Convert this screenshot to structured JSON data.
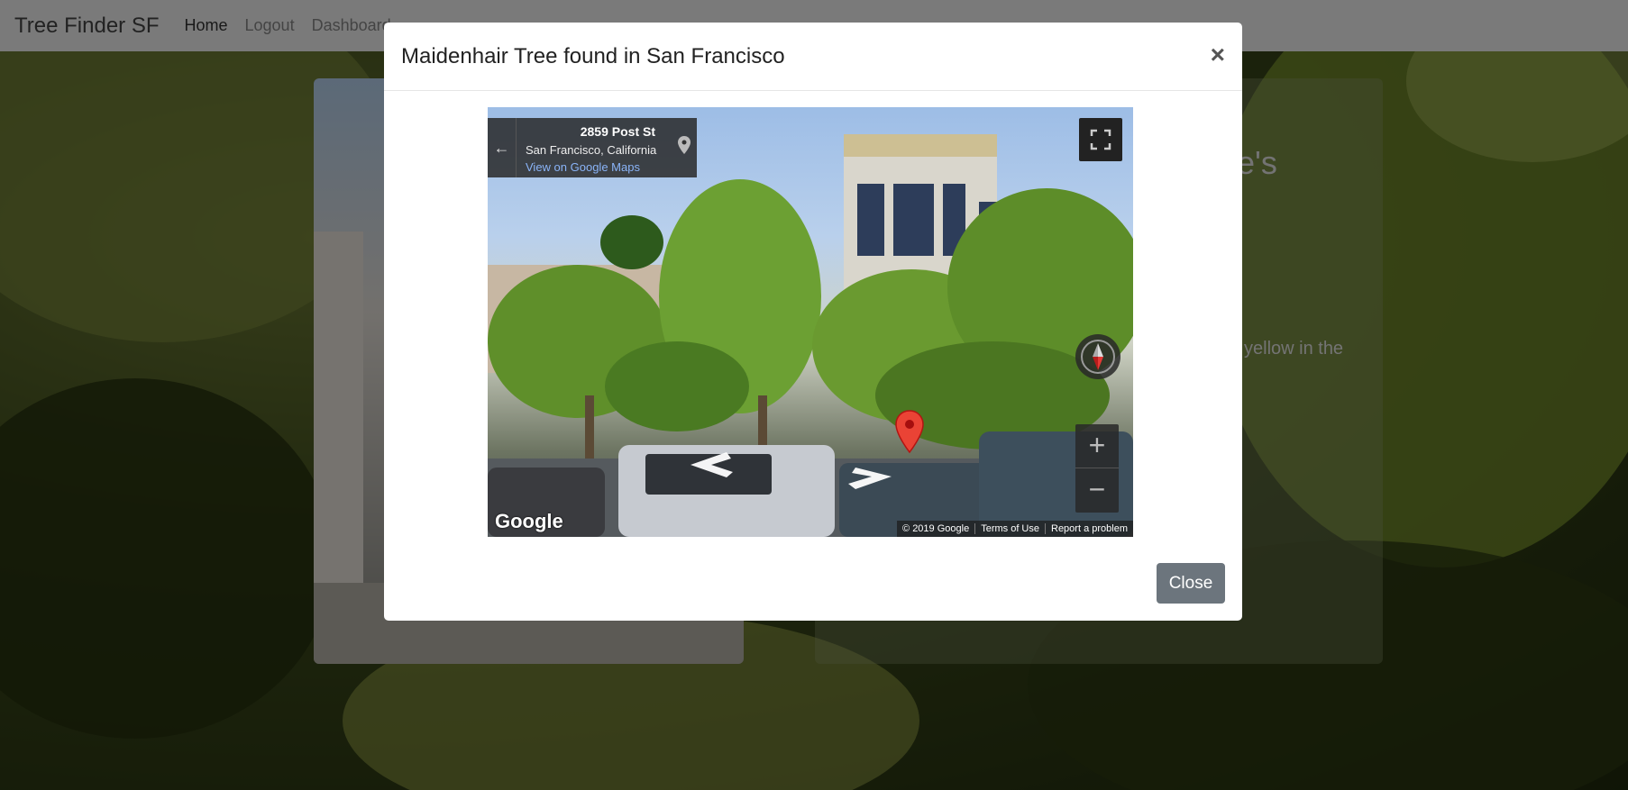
{
  "navbar": {
    "brand": "Tree Finder SF",
    "links": [
      "Home",
      "Logout",
      "Dashboard"
    ]
  },
  "background_page": {
    "title_fragment": "e's",
    "text_fragment": "yellow in the"
  },
  "modal": {
    "title": "Maidenhair Tree found in San Francisco",
    "close_x": "×",
    "close_button": "Close",
    "street_view": {
      "address": "2859 Post St",
      "city": "San Francisco, California",
      "maps_link": "View on Google Maps",
      "back_arrow": "←",
      "logo": "Google",
      "zoom_in": "+",
      "zoom_out": "−",
      "footer": [
        "© 2019 Google",
        "Terms of Use",
        "Report a problem"
      ]
    }
  },
  "colors": {
    "navbar_bg": "#f5f5f5",
    "close_button_bg": "#6c757d",
    "marker": "#ea4335",
    "maps_link": "#8ab4f8"
  },
  "icons": [
    "back-arrow-icon",
    "location-pin-icon",
    "fullscreen-icon",
    "compass-icon",
    "map-marker-icon",
    "close-icon"
  ]
}
